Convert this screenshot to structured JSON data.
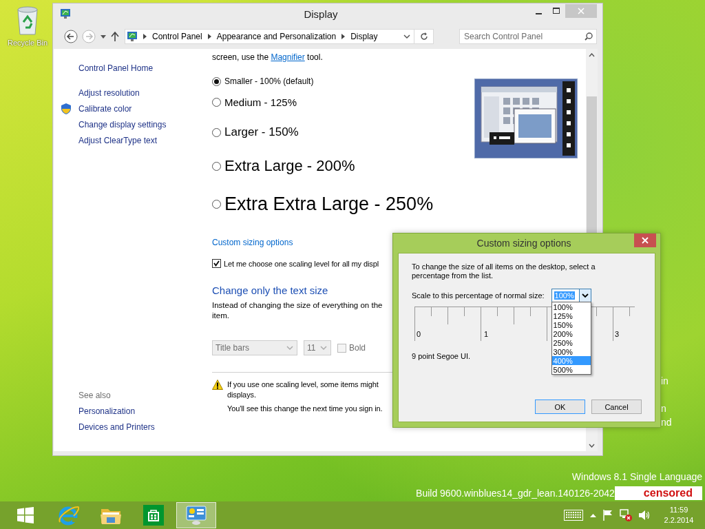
{
  "desktop": {
    "icons": [
      {
        "label": "Recycle Bin"
      }
    ],
    "fragments": [
      "in",
      "n",
      "nd"
    ],
    "edition": "Windows 8.1 Single Language",
    "build": "Build 9600.winblues14_gdr_lean.140126-2042",
    "censor_label": "censored"
  },
  "window": {
    "title": "Display",
    "path": [
      "Control Panel",
      "Appearance and Personalization",
      "Display"
    ],
    "search_placeholder": "Search Control Panel",
    "sidebar": {
      "home": "Control Panel Home",
      "links": [
        {
          "label": "Adjust resolution",
          "shield": false
        },
        {
          "label": "Calibrate color",
          "shield": true
        },
        {
          "label": "Change display settings",
          "shield": false
        },
        {
          "label": "Adjust ClearType text",
          "shield": false
        }
      ],
      "see_also_title": "See also",
      "see_also": [
        "Personalization",
        "Devices and Printers"
      ]
    },
    "intro": {
      "before": "screen, use the ",
      "link": "Magnifier",
      "after": " tool."
    },
    "scale_options": [
      {
        "label": "Smaller - 100% (default)",
        "selected": true
      },
      {
        "label": "Medium - 125%",
        "selected": false
      },
      {
        "label": "Larger - 150%",
        "selected": false
      },
      {
        "label": "Extra Large - 200%",
        "selected": false
      },
      {
        "label": "Extra Extra Large - 250%",
        "selected": false
      }
    ],
    "custom_sizing_link": "Custom sizing options",
    "one_level_checkbox": {
      "label": "Let me choose one scaling level for all my displ",
      "checked": true
    },
    "text_size": {
      "heading": "Change only the text size",
      "description_lines": [
        "Instead of changing the size of everything on the",
        "item."
      ],
      "item_dropdown": {
        "value": "Title bars",
        "disabled": true
      },
      "size_dropdown": {
        "value": "11",
        "disabled": true
      },
      "bold": {
        "label": "Bold",
        "checked": false,
        "disabled": true
      }
    },
    "warning": {
      "lines": [
        "If you use one scaling level, some items might",
        "displays."
      ],
      "note": "You'll see this change the next time you sign in."
    }
  },
  "dialog": {
    "title": "Custom sizing options",
    "instructions": "To change the size of all items on the desktop, select a percentage from the list.",
    "scale_label": "Scale to this percentage of normal size:",
    "combo_value": "100%",
    "options": [
      {
        "label": "100%",
        "selected": false
      },
      {
        "label": "125%",
        "selected": false
      },
      {
        "label": "150%",
        "selected": false
      },
      {
        "label": "200%",
        "selected": false
      },
      {
        "label": "250%",
        "selected": false
      },
      {
        "label": "300%",
        "selected": false
      },
      {
        "label": "400%",
        "selected": true
      },
      {
        "label": "500%",
        "selected": false
      }
    ],
    "ruler_labels": [
      "0",
      "1",
      "3"
    ],
    "font_note": "9 point Segoe UI.",
    "buttons": [
      {
        "label": "OK",
        "default": true
      },
      {
        "label": "Cancel",
        "default": false
      }
    ]
  },
  "taskbar": {
    "apps": [
      {
        "kind": "start",
        "active": false
      },
      {
        "kind": "browser",
        "active": false
      },
      {
        "kind": "folder",
        "active": false
      },
      {
        "kind": "store",
        "active": false
      },
      {
        "kind": "control-panel",
        "active": true
      }
    ],
    "time": "11:59",
    "date": "2.2.2014"
  }
}
